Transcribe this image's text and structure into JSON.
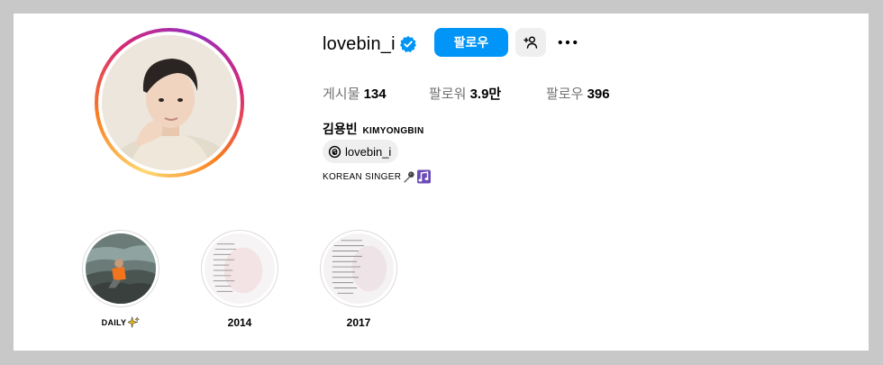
{
  "profile": {
    "username": "lovebin_i",
    "verified": true,
    "follow_label": "팔로우",
    "icons": {
      "verified": "verified-badge-icon",
      "suggest": "add-person-icon",
      "more": "more-horizontal-icon"
    },
    "stats": {
      "posts_label": "게시물",
      "posts_value": "134",
      "followers_label": "팔로워",
      "followers_value": "3.9만",
      "following_label": "팔로우",
      "following_value": "396"
    },
    "full_name_ko": "김용빈",
    "full_name_en": "KIMYONGBIN",
    "threads_handle": "lovebin_i",
    "bio": "KOREAN SINGER"
  },
  "highlights": [
    {
      "label": "DAILY"
    },
    {
      "label": "2014"
    },
    {
      "label": "2017"
    }
  ],
  "colors": {
    "accent": "#0095f6",
    "verified": "#0095f6",
    "muted_text": "#737373",
    "button_gray": "#efefef"
  }
}
